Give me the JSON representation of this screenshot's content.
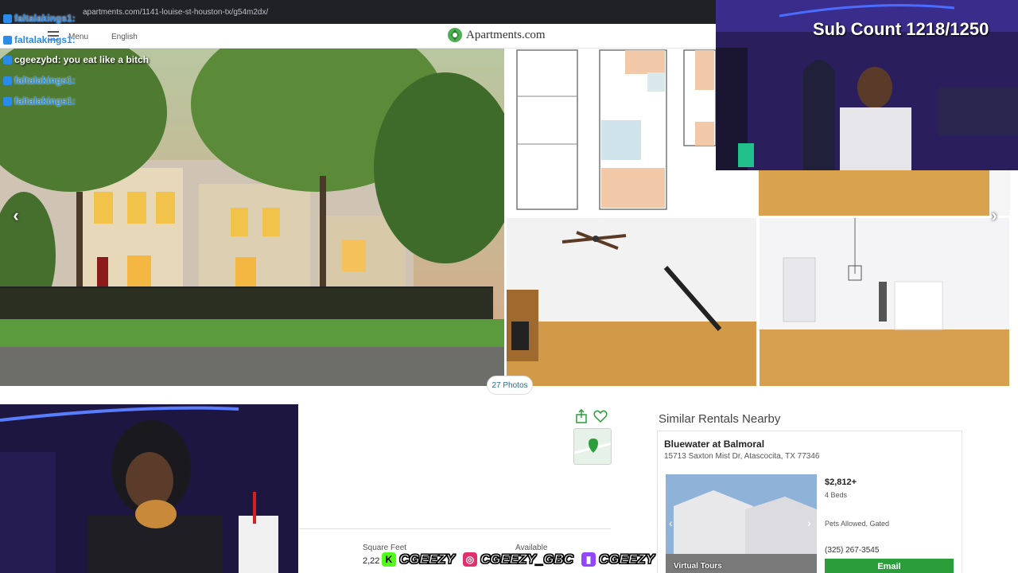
{
  "browser": {
    "url": "apartments.com/1141-louise-st-houston-tx/g54m2dx/"
  },
  "header": {
    "menu_label": "Menu",
    "language": "English",
    "logo_text": "Apartments.com",
    "logo_icon": "recycle-leaf-icon"
  },
  "gallery": {
    "photos_label": "27 Photos",
    "prev_icon": "chevron-left-icon",
    "next_icon": "chevron-right-icon"
  },
  "chat": {
    "messages": [
      {
        "user": "faltalakings1:",
        "text": ""
      },
      {
        "user": "faltalakings1:",
        "text": ""
      },
      {
        "user": "cgeezybd:",
        "text": "you eat like a bitch"
      },
      {
        "user": "faltalakings1:",
        "text": ""
      },
      {
        "user": "faltalakings1:",
        "text": ""
      }
    ]
  },
  "stream": {
    "sub_count": "Sub Count 1218/1250"
  },
  "listing": {
    "share_icon": "share-icon",
    "favorite_icon": "heart-icon",
    "square_feet_label": "Square Feet",
    "square_feet_value": "2,22",
    "available_label": "Available"
  },
  "similar": {
    "title": "Similar Rentals Nearby",
    "card": {
      "name": "Bluewater at Balmoral",
      "address": "15713 Saxton Mist Dr, Atascocita, TX 77346",
      "price": "$2,812+",
      "beds": "4 Beds",
      "amenities": "Pets Allowed, Gated",
      "phone": "(325) 267-3545",
      "email_label": "Email",
      "virtual_tours": "Virtual Tours"
    }
  },
  "socials": [
    {
      "icon": "kick-icon",
      "handle": "CGEEZY",
      "color": "#53fc18"
    },
    {
      "icon": "instagram-icon",
      "handle": "CGEEZY_GBC",
      "color": "#e1306c"
    },
    {
      "icon": "twitch-icon",
      "handle": "CGEEZY",
      "color": "#9146ff"
    }
  ]
}
